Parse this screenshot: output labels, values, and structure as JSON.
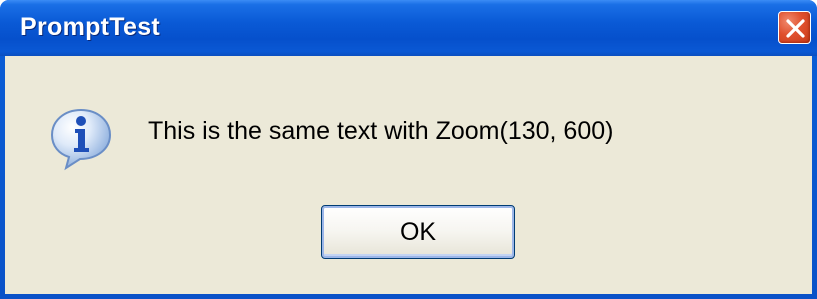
{
  "window": {
    "title": "PromptTest"
  },
  "dialog": {
    "message": "This is the same text with Zoom(130, 600)",
    "icon": "information-icon",
    "ok_label": "OK"
  },
  "titlebar": {
    "close_icon": "close-icon"
  },
  "colors": {
    "titlebar_blue": "#0a5ad6",
    "dialog_background": "#ece9d8",
    "close_red": "#e0502e"
  }
}
